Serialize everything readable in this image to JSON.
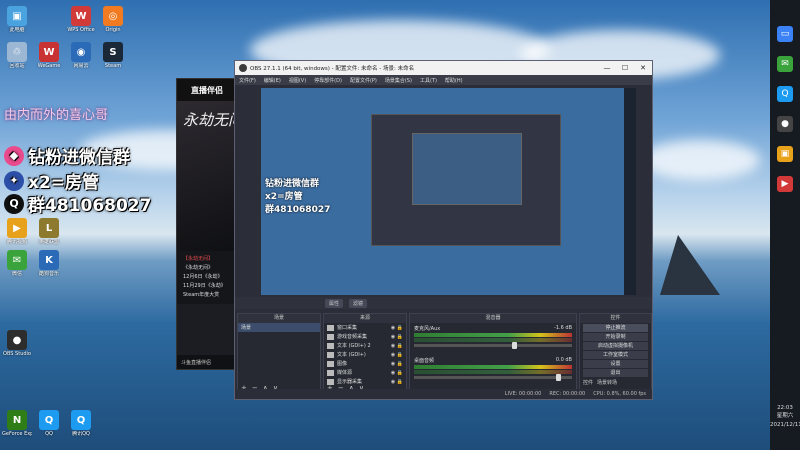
{
  "desktop_icons": [
    {
      "label": "此电脑",
      "color": "#4aa3df",
      "glyph": "▣"
    },
    {
      "label": "WPS Office",
      "color": "#d23a3a",
      "glyph": "W"
    },
    {
      "label": "Origin",
      "color": "#f27b21",
      "glyph": "◎"
    },
    {
      "label": "回收站",
      "color": "#9bb7d4",
      "glyph": "♲"
    },
    {
      "label": "WeGame",
      "color": "#c83232",
      "glyph": "W"
    },
    {
      "label": "网易云",
      "color": "#2a6ab7",
      "glyph": "◉"
    },
    {
      "label": "Steam",
      "color": "#1b2838",
      "glyph": "S"
    },
    {
      "label": "腾讯视频",
      "color": "#e8a11a",
      "glyph": "▶"
    },
    {
      "label": "英雄联盟",
      "color": "#8e7a2e",
      "glyph": "L"
    },
    {
      "label": "OBS Studio",
      "color": "#2d2d2d",
      "glyph": "●"
    },
    {
      "label": "GeForce Experience",
      "color": "#2f7d16",
      "glyph": "N"
    },
    {
      "label": "QQ",
      "color": "#1d9bf0",
      "glyph": "Q"
    },
    {
      "label": "微信",
      "color": "#3aa33b",
      "glyph": "✉"
    },
    {
      "label": "酷狗音乐",
      "color": "#2a6ab7",
      "glyph": "K"
    },
    {
      "label": "腾讯QQ",
      "color": "#1d9bf0",
      "glyph": "Q"
    }
  ],
  "overlay": {
    "watermark": "由内而外的喜心哥",
    "line1": "钻粉进微信群",
    "line2": "x2=房管",
    "line3": "群481068027"
  },
  "live_app": {
    "title": "直播伴侣",
    "banner_text": "永劫无间",
    "news_title": "【永劫无间】",
    "news": [
      "《永劫无间》",
      "12月6日《永劫》",
      "11月29日《永劫》",
      "Steam年度大赏"
    ],
    "footer": "斗鱼直播伴侣"
  },
  "obs": {
    "title": "OBS 27.1.1 (64 bit, windows) - 配置文件: 未命名 - 场景: 未命名",
    "window_controls": [
      "—",
      "☐",
      "✕"
    ],
    "menu": [
      "文件(F)",
      "编辑(E)",
      "视图(V)",
      "停靠部件(D)",
      "配置文件(P)",
      "场景集合(S)",
      "工具(T)",
      "帮助(H)"
    ],
    "source_bar": [
      "属性",
      "滤镜"
    ],
    "preview_lines": [
      "钻粉进微信群",
      "x2=房管",
      "群481068027"
    ],
    "scenes": {
      "header": "场景",
      "items": [
        "场景"
      ]
    },
    "sources": {
      "header": "来源",
      "items": [
        "窗口采集",
        "游戏音频采集",
        "文本 (GDI+) 2",
        "文本 (GDI+)",
        "图像",
        "媒体源",
        "显示器采集"
      ]
    },
    "mixer": {
      "header": "混音器",
      "tracks": [
        {
          "name": "麦克风/Aux",
          "db": "-1.6 dB"
        },
        {
          "name": "桌面音频",
          "db": "0.0 dB"
        }
      ]
    },
    "controls": {
      "header": "控件",
      "buttons": [
        "停止推流",
        "开始录制",
        "启动虚拟摄像机",
        "工作室模式",
        "设置",
        "退出"
      ],
      "tabs": [
        "控件",
        "场景转场"
      ]
    },
    "status": [
      "LIVE: 00:00:00",
      "REC: 00:00:00",
      "CPU: 0.8%, 60.00 fps"
    ],
    "dock_tools": [
      "+",
      "−",
      "∧",
      "∨"
    ]
  },
  "taskbar": {
    "icons": [
      {
        "name": "task-view-icon",
        "color": "#3b82f6",
        "glyph": "▭"
      },
      {
        "name": "wechat-icon",
        "color": "#3aa33b",
        "glyph": "✉"
      },
      {
        "name": "qq-icon",
        "color": "#1d9bf0",
        "glyph": "Q"
      },
      {
        "name": "obs-icon",
        "color": "#444",
        "glyph": "●"
      },
      {
        "name": "app-icon",
        "color": "#e8a11a",
        "glyph": "▣"
      },
      {
        "name": "live-icon",
        "color": "#d23a3a",
        "glyph": "▶"
      }
    ],
    "time": "22:03",
    "weekday": "星期六",
    "date": "2021/12/11"
  }
}
